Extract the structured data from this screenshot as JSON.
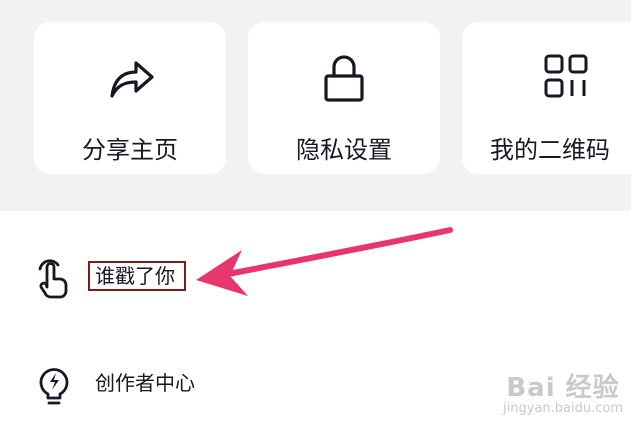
{
  "quick_actions": [
    {
      "label": "分享主页",
      "icon": "share-icon"
    },
    {
      "label": "隐私设置",
      "icon": "lock-icon"
    },
    {
      "label": "我的二维码",
      "icon": "qr-code-icon"
    }
  ],
  "menu": {
    "items": [
      {
        "label": "谁戳了你",
        "icon": "poke-hand-icon"
      },
      {
        "label": "创作者中心",
        "icon": "lightbulb-icon"
      }
    ]
  },
  "annotation": {
    "color": "#e8356d",
    "box_color": "#7a1a1a"
  },
  "watermark": {
    "main": "Bai 经验",
    "sub": "jingyan.baidu.com"
  }
}
